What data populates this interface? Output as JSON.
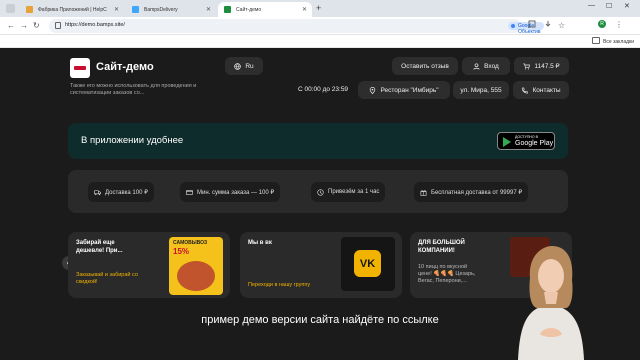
{
  "browser": {
    "tabs": [
      {
        "title": "Фабрика Приложений | HelpC",
        "favicon_color": "#e8a23a",
        "active": false
      },
      {
        "title": "BampsDelivery",
        "favicon_color": "#3ea6ff",
        "active": false
      },
      {
        "title": "Сайт-демо",
        "favicon_color": "#1e8e3e",
        "active": true
      }
    ],
    "url": "https://demo.bamps.site/",
    "lens_label": "Google Объектив",
    "bookmarks_label": "Все закладки",
    "profile_initial": "R"
  },
  "header": {
    "title": "Сайт-демо",
    "description": "Также его можно использовать для проведения и систематизации заказов со...",
    "language": "Ru",
    "review_btn": "Оставить отзыв",
    "login_btn": "Вход",
    "cart_total": "1147.5 ₽",
    "hours": "С 00:00 до 23:59",
    "restaurant": "Ресторан \"Имбирь\"",
    "address": "ул. Мира, 555",
    "contacts": "Контакты"
  },
  "banner": {
    "text": "В приложении удобнее",
    "badge_small": "ДОСТУПНО В",
    "badge_big": "Google Play"
  },
  "info_chips": [
    {
      "icon": "truck-icon",
      "label": "Доставка 100 ₽"
    },
    {
      "icon": "card-icon",
      "label": "Мин. сумма заказа — 100 ₽"
    },
    {
      "icon": "clock-icon",
      "label": "Привезём за 1 час"
    },
    {
      "icon": "gift-icon",
      "label": "Бесплатная доставка от 99997 ₽"
    }
  ],
  "promos": [
    {
      "title_1": "Забирай еще",
      "title_2": "дешевле! При...",
      "link_1": "Заказывай и забирай со",
      "link_2": "скидкой!",
      "badge": "САМОВЫВОЗ",
      "percent": "15%"
    },
    {
      "title": "Мы в вк",
      "link": "Переходи в нашу группу",
      "logo": "VK"
    },
    {
      "title_1": "ДЛЯ БОЛЬШОЙ",
      "title_2": "КОМПАНИИ!",
      "sub_1": "10 пицц по вкусной",
      "sub_2": "цене! 🍕🍕🍕 Цезарь,",
      "sub_3": "Вегас, Пеперони,..."
    }
  ],
  "subtitle": "пример демо версии сайта найдёте по ссылке",
  "colors": {
    "accent": "#f2b200",
    "banner_bg": "#0f2c2c",
    "page_bg": "#1b1b1b"
  }
}
